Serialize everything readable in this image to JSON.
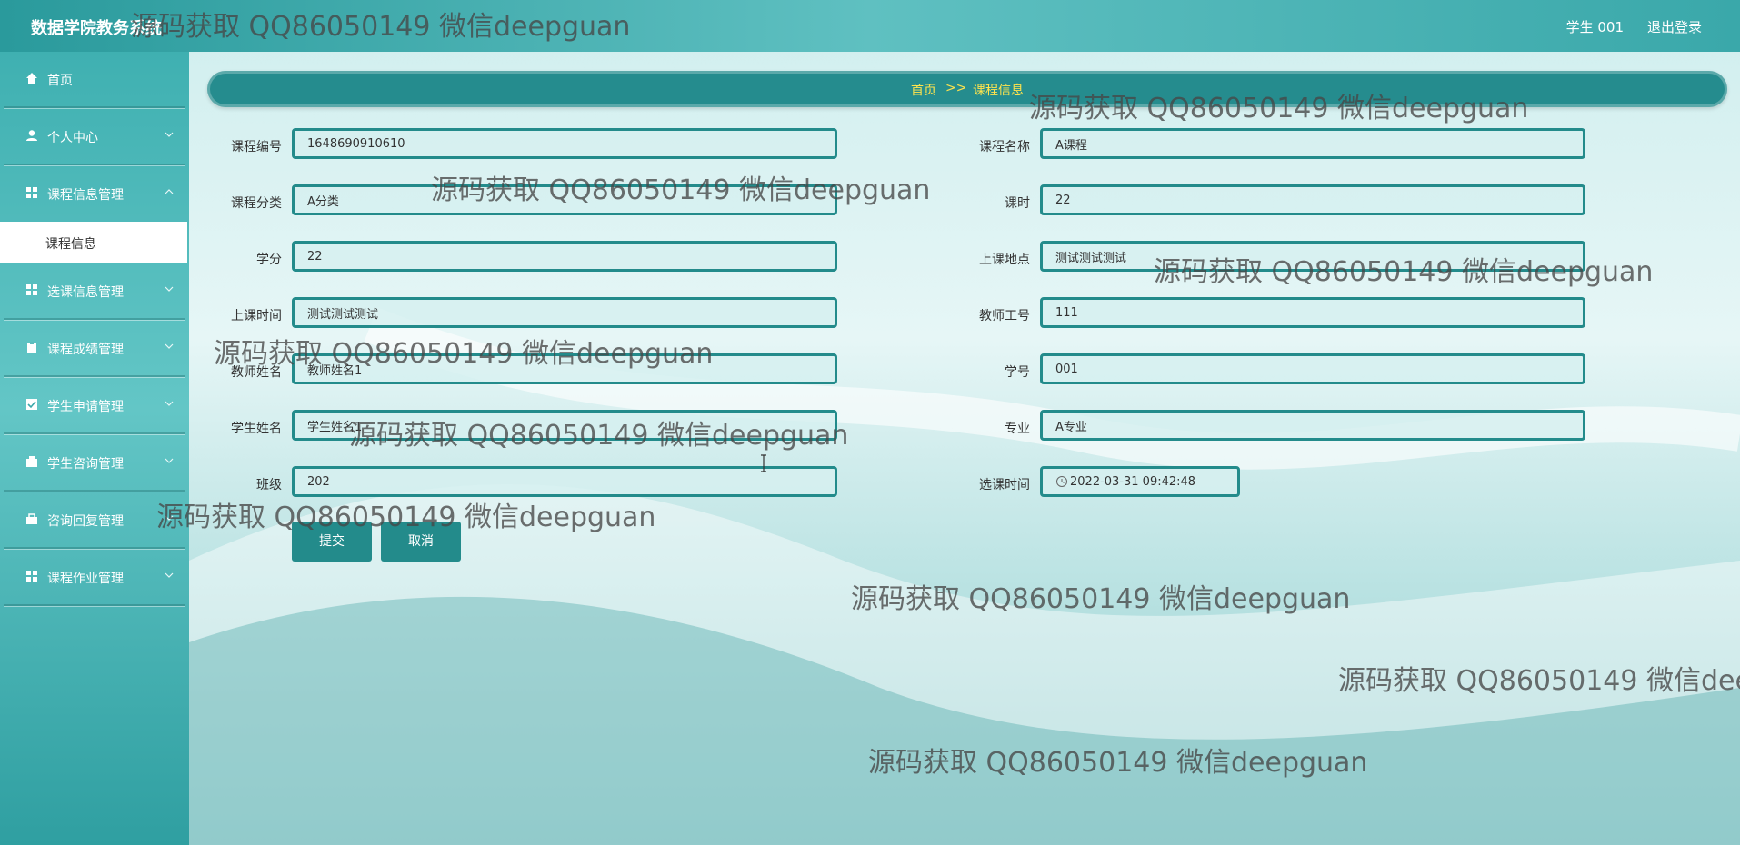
{
  "header": {
    "app_title": "数据学院教务系统",
    "user_label": "学生 001",
    "logout_label": "退出登录"
  },
  "sidebar": {
    "items": [
      {
        "label": "首页",
        "icon": "home-icon"
      },
      {
        "label": "个人中心",
        "icon": "user-icon"
      },
      {
        "label": "课程信息管理",
        "icon": "grid-icon"
      },
      {
        "label": "选课信息管理",
        "icon": "grid-icon"
      },
      {
        "label": "课程成绩管理",
        "icon": "clipboard-icon"
      },
      {
        "label": "学生申请管理",
        "icon": "checklist-icon"
      },
      {
        "label": "学生咨询管理",
        "icon": "chat-icon"
      },
      {
        "label": "咨询回复管理",
        "icon": "box-icon"
      },
      {
        "label": "课程作业管理",
        "icon": "grid-icon"
      }
    ],
    "active_sub": "课程信息"
  },
  "breadcrumb": {
    "home": "首页",
    "sep": ">>",
    "current": "课程信息"
  },
  "form": {
    "course_no": {
      "label": "课程编号",
      "value": "1648690910610"
    },
    "course_name": {
      "label": "课程名称",
      "value": "A课程"
    },
    "category": {
      "label": "课程分类",
      "value": "A分类"
    },
    "hours": {
      "label": "课时",
      "value": "22"
    },
    "credit": {
      "label": "学分",
      "value": "22"
    },
    "location": {
      "label": "上课地点",
      "value": "测试测试测试"
    },
    "time": {
      "label": "上课时间",
      "value": "测试测试测试"
    },
    "teacher_no": {
      "label": "教师工号",
      "value": "111"
    },
    "teacher_name": {
      "label": "教师姓名",
      "value": "教师姓名1"
    },
    "student_no": {
      "label": "学号",
      "value": "001"
    },
    "student_name": {
      "label": "学生姓名",
      "value": "学生姓名1"
    },
    "major": {
      "label": "专业",
      "value": "A专业"
    },
    "class": {
      "label": "班级",
      "value": "202"
    },
    "select_time": {
      "label": "选课时间",
      "value": "2022-03-31 09:42:48"
    }
  },
  "buttons": {
    "submit": "提交",
    "cancel": "取消"
  },
  "watermark": "源码获取 QQ86050149 微信deepguan",
  "colors": {
    "accent": "#238b8b",
    "breadcrumb_text": "#ffe44d"
  }
}
